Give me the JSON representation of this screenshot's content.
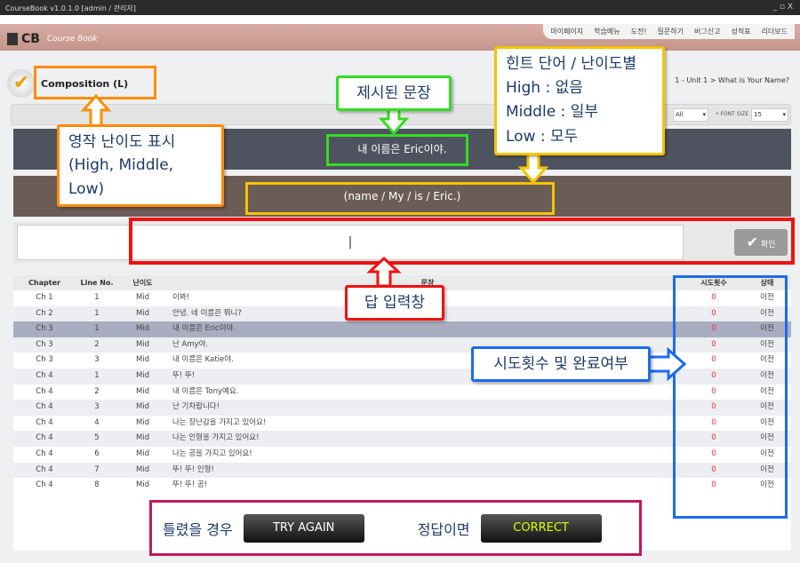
{
  "window": {
    "title": "CourseBook v1.0.1.0 [admin / 관리자]",
    "controls": "_ ▫ X"
  },
  "nav": [
    "마이페이지",
    "학습메뉴",
    "도전!",
    "질문하기",
    "버그신고",
    "성적표",
    "리더보드"
  ],
  "logo": {
    "text": "CB",
    "subtitle": "Course Book"
  },
  "breadcrumb": "1 - Unit 1 > What is Your Name?",
  "composition": {
    "label": "Composition (L)"
  },
  "toolbar": {
    "select_value": "All",
    "font_size_label": "• FONT SIZE",
    "font_size": "15"
  },
  "sentence": "내 이름은 Eric이야.",
  "hint": "(name / My / is / Eric.)",
  "answer": {
    "value": "|"
  },
  "confirm_label": "확인",
  "table": {
    "headers": [
      "Chapter",
      "Line No.",
      "난이도",
      "문장",
      "시도횟수",
      "상태"
    ],
    "selected_index": 2,
    "rows": [
      [
        "Ch 1",
        "1",
        "Mid",
        "이봐!",
        "0",
        "이전"
      ],
      [
        "Ch 2",
        "1",
        "Mid",
        "안녕. 네 이름은 뭐니?",
        "0",
        "이전"
      ],
      [
        "Ch 3",
        "1",
        "Mid",
        "내 이름은 Eric이야.",
        "0",
        "이전"
      ],
      [
        "Ch 3",
        "2",
        "Mid",
        "난 Amy야.",
        "0",
        "이전"
      ],
      [
        "Ch 3",
        "3",
        "Mid",
        "내 이름은 Katie야.",
        "0",
        "이전"
      ],
      [
        "Ch 4",
        "1",
        "Mid",
        "뚜! 뚜!",
        "0",
        "이전"
      ],
      [
        "Ch 4",
        "2",
        "Mid",
        "내 이름은 Tony예요.",
        "0",
        "이전"
      ],
      [
        "Ch 4",
        "3",
        "Mid",
        "난 기차랍니다!",
        "0",
        "이전"
      ],
      [
        "Ch 4",
        "4",
        "Mid",
        "나는 장난감을 가지고 있어요!",
        "0",
        "이전"
      ],
      [
        "Ch 4",
        "5",
        "Mid",
        "나는 인형을 가지고 있어요!",
        "0",
        "이전"
      ],
      [
        "Ch 4",
        "6",
        "Mid",
        "나는 공을 가지고 있어요!",
        "0",
        "이전"
      ],
      [
        "Ch 4",
        "7",
        "Mid",
        "뚜! 뚜! 인형!",
        "0",
        "이전"
      ],
      [
        "Ch 4",
        "8",
        "Mid",
        "뚜! 뚜! 공!",
        "0",
        "이전"
      ]
    ]
  },
  "annotations": {
    "difficulty": [
      "영작 난이도 표시",
      "(High, Middle, Low)"
    ],
    "sentence": "제시된 문장",
    "hint": [
      "힌트 단어 / 난이도별",
      "High : 없음",
      "Middle : 일부",
      "Low : 모두"
    ],
    "answer": "답 입력창",
    "attempts": "시도횟수 및 완료여부",
    "wrong_label": "틀렸을 경우",
    "try_again": "TRY AGAIN",
    "right_label": "정답이면",
    "correct": "CORRECT"
  },
  "colors": {
    "orange": "#ff8c00",
    "green": "#33dd22",
    "yellow": "#f5c400",
    "red": "#ee1111",
    "blue": "#1a6cf0",
    "magenta": "#c2185b",
    "correct_text": "#d8ff00"
  }
}
